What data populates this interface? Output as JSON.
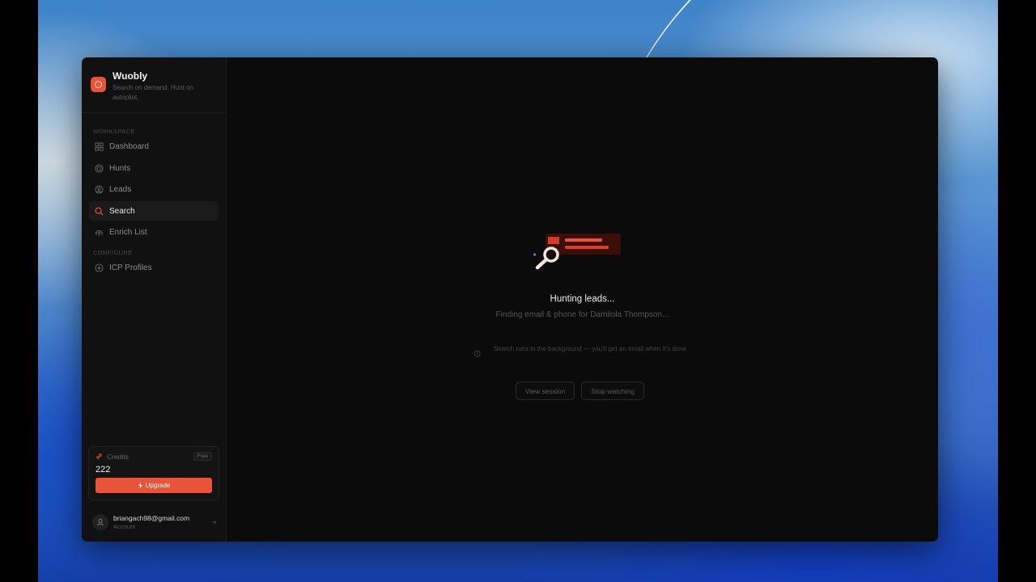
{
  "app": {
    "name": "Wuobly",
    "tagline": "Search on demand. Hunt on autopilot.",
    "accent_color": "#e8533a"
  },
  "sidebar": {
    "workspace_label": "WORKSPACE",
    "configure_label": "CONFIGURE",
    "workspace_items": [
      {
        "label": "Dashboard",
        "icon": "grid-icon"
      },
      {
        "label": "Hunts",
        "icon": "target-icon"
      },
      {
        "label": "Leads",
        "icon": "user-circle-icon"
      },
      {
        "label": "Search",
        "icon": "search-icon",
        "active": true
      },
      {
        "label": "Enrich List",
        "icon": "cloud-upload-icon"
      }
    ],
    "configure_items": [
      {
        "label": "ICP Profiles",
        "icon": "plus-circle-icon"
      }
    ]
  },
  "credits": {
    "label": "Credits",
    "plan": "Free",
    "value": "222",
    "upgrade_label": "Upgrade"
  },
  "account": {
    "email": "briangach98@gmail.com",
    "sub": "Account"
  },
  "status": {
    "title": "Hunting leads...",
    "subtitle": "Finding email & phone for Damilola Thompson...",
    "note": "Search runs in the background — you'll get an email when it's done"
  },
  "actions": {
    "view_session": "View session",
    "stop_watching": "Stop watching"
  }
}
